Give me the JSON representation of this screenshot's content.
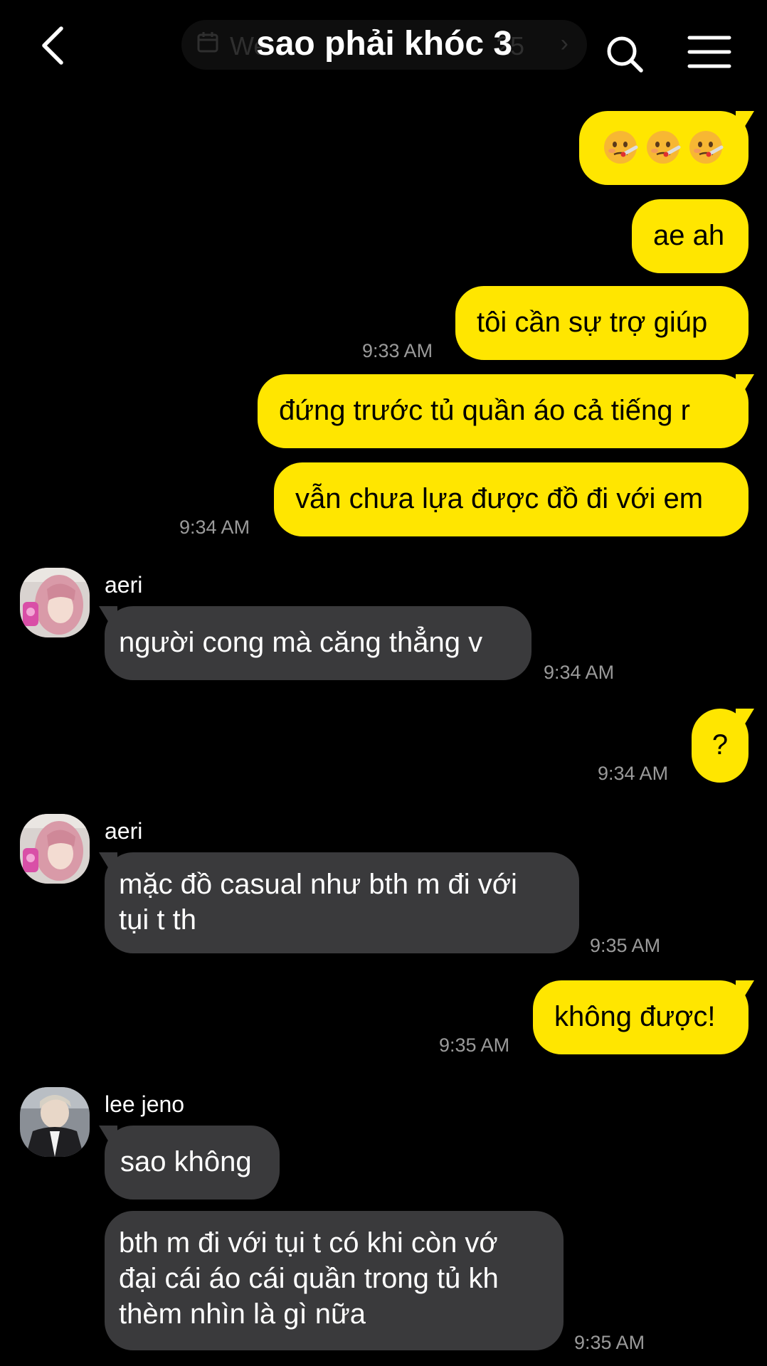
{
  "header": {
    "title": "sao phải khóc 3",
    "ghost_pill_text": "We",
    "ghost_pill_tail": "25",
    "ghost_pill_chevron": "›"
  },
  "icons": {
    "back": "chevron-left-icon",
    "search": "search-icon",
    "menu": "hamburger-menu-icon",
    "calendar": "calendar-icon",
    "emoji": "face-with-thermometer-emoji"
  },
  "colors": {
    "background": "#000000",
    "outgoing_bubble": "#ffe600",
    "incoming_bubble": "#3a3a3c",
    "timestamp": "#9a9a9a"
  },
  "messages": {
    "m1": {
      "text": "🤒🤒🤒"
    },
    "m2": {
      "text": "ae ah"
    },
    "m3": {
      "text": "tôi cần sự trợ giúp",
      "time": "9:33 AM"
    },
    "m4": {
      "text": "đứng trước tủ quần áo cả tiếng r"
    },
    "m5": {
      "text": "vẫn chưa lựa được đồ đi với em",
      "time": "9:34 AM"
    },
    "m6": {
      "sender": "aeri",
      "text": "người cong mà căng thẳng v",
      "time": "9:34 AM"
    },
    "m7": {
      "text": "?",
      "time": "9:34 AM"
    },
    "m8": {
      "sender": "aeri",
      "text": "mặc đồ casual như bth m đi với tụi t th",
      "line1": "mặc đồ casual như bth m đi với",
      "line2": "tụi t th",
      "time": "9:35 AM"
    },
    "m9": {
      "text": "không được!",
      "time": "9:35 AM"
    },
    "m10": {
      "sender": "lee jeno",
      "text": "sao không"
    },
    "m11": {
      "line1": "bth m đi với tụi t có khi còn vớ",
      "line2": "đại cái áo cái quần trong tủ kh",
      "line3": "thèm nhìn là gì nữa",
      "time": "9:35 AM"
    }
  }
}
